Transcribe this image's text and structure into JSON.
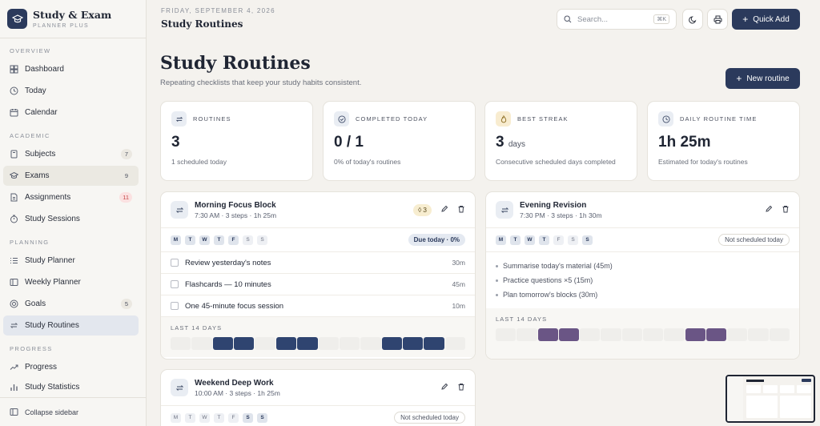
{
  "brand": {
    "title": "Study & Exam",
    "subtitle": "PLANNER PLUS"
  },
  "sidebar": {
    "sections": [
      {
        "title": "OVERVIEW",
        "items": [
          {
            "label": "Dashboard",
            "icon": "grid-icon"
          },
          {
            "label": "Today",
            "icon": "clock-icon"
          },
          {
            "label": "Calendar",
            "icon": "calendar-icon"
          }
        ]
      },
      {
        "title": "ACADEMIC",
        "items": [
          {
            "label": "Subjects",
            "icon": "book-icon",
            "badge": "7"
          },
          {
            "label": "Exams",
            "icon": "graduation-cap-icon",
            "badge": "9"
          },
          {
            "label": "Assignments",
            "icon": "file-icon",
            "badge": "11"
          },
          {
            "label": "Study Sessions",
            "icon": "timer-icon"
          }
        ]
      },
      {
        "title": "PLANNING",
        "items": [
          {
            "label": "Study Planner",
            "icon": "list-icon"
          },
          {
            "label": "Weekly Planner",
            "icon": "columns-icon"
          },
          {
            "label": "Goals",
            "icon": "target-icon",
            "badge": "5"
          },
          {
            "label": "Study Routines",
            "icon": "repeat-icon"
          }
        ]
      },
      {
        "title": "PROGRESS",
        "items": [
          {
            "label": "Progress",
            "icon": "trend-icon"
          },
          {
            "label": "Study Statistics",
            "icon": "bar-chart-icon"
          }
        ]
      }
    ],
    "collapse_label": "Collapse sidebar"
  },
  "header": {
    "date": "FRIDAY, SEPTEMBER 4, 2026",
    "title": "Study Routines",
    "search_placeholder": "Search...",
    "search_shortcut": "⌘K",
    "quick_add": "Quick Add"
  },
  "page": {
    "title": "Study Routines",
    "description": "Repeating checklists that keep your study habits consistent.",
    "new_button": "New routine"
  },
  "stats": [
    {
      "label": "ROUTINES",
      "value": "3",
      "unit": "",
      "sub": "1 scheduled today"
    },
    {
      "label": "COMPLETED TODAY",
      "value": "0 / 1",
      "unit": "",
      "sub": "0% of today's routines"
    },
    {
      "label": "BEST STREAK",
      "value": "3",
      "unit": "days",
      "sub": "Consecutive scheduled days completed"
    },
    {
      "label": "DAILY ROUTINE TIME",
      "value": "1h 25m",
      "unit": "",
      "sub": "Estimated for today's routines"
    }
  ],
  "day_letters": [
    "M",
    "T",
    "W",
    "T",
    "F",
    "S",
    "S"
  ],
  "history_label": "LAST 14 DAYS",
  "routines": [
    {
      "title": "Morning Focus Block",
      "meta": "7:30 AM · 3 steps · 1h 25m",
      "streak": "3",
      "status": "Due today · 0%",
      "steps": [
        {
          "label": "Review yesterday's notes",
          "duration": "30m"
        },
        {
          "label": "Flashcards — 10 minutes",
          "duration": "45m"
        },
        {
          "label": "One 45-minute focus session",
          "duration": "10m"
        }
      ],
      "history": [
        0,
        0,
        1,
        1,
        0,
        1,
        1,
        0,
        0,
        0,
        1,
        1,
        1,
        0
      ],
      "color": "#2f4470"
    },
    {
      "title": "Evening Revision",
      "meta": "7:30 PM · 3 steps · 1h 30m",
      "status": "Not scheduled today",
      "bullets": [
        "Summarise today's material (45m)",
        "Practice questions ×5 (15m)",
        "Plan tomorrow's blocks (30m)"
      ],
      "history": [
        0,
        0,
        1,
        1,
        0,
        0,
        0,
        0,
        0,
        1,
        1,
        0,
        0,
        0
      ],
      "color": "#6a5585"
    },
    {
      "title": "Weekend Deep Work",
      "meta": "10:00 AM · 3 steps · 1h 25m",
      "status": "Not scheduled today"
    }
  ],
  "colors": {
    "accent": "#2b3a5c",
    "sidebar_bg": "#f7f6f3",
    "page_bg": "#f4f2ee"
  }
}
